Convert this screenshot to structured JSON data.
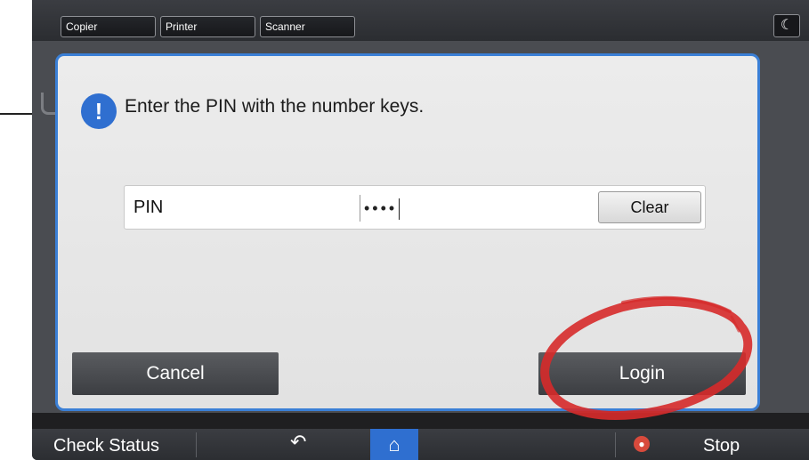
{
  "top_tabs": [
    "Copier",
    "Printer",
    "Scanner"
  ],
  "dialog": {
    "message": "Enter the PIN with the number keys.",
    "pin_label": "PIN",
    "pin_value": "••••",
    "clear_label": "Clear",
    "cancel_label": "Cancel",
    "login_label": "Login"
  },
  "bottom_bar": {
    "check_status_label": "Check Status",
    "stop_label": "Stop"
  },
  "colors": {
    "accent": "#2f6fd0",
    "dialog_border": "#3a7fd6",
    "annotation": "#d62a2a",
    "stop": "#d84a3c"
  },
  "icons": [
    "moon-icon",
    "alert-icon",
    "back-icon",
    "home-icon",
    "stop-icon"
  ]
}
